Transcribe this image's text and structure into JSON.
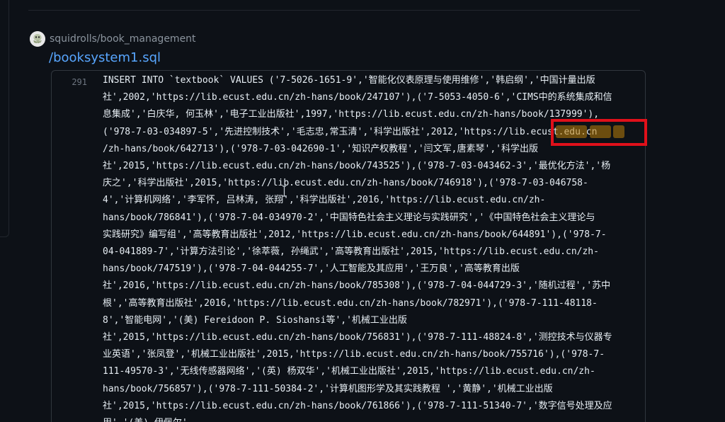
{
  "repo": {
    "name": "squidrolls/book_management",
    "avatar_icon": "squid-avatar-icon"
  },
  "file": {
    "path": "/booksystem1.sql"
  },
  "result": {
    "line_number": "291",
    "code_lines": [
      "INSERT INTO `textbook` VALUES ('7-5026-1651-9','智能化仪表原理与使用维修','韩启纲','中国计量出版",
      "社',2002,'https://lib.ecust.edu.cn/zh-hans/book/247107'),('7-5053-4050-6','CIMS中的系统集成和信",
      "息集成','白庆华, 何玉林','电子工业出版社',1997,'https://lib.ecust.edu.cn/zh-hans/book/137999'),",
      "('978-7-03-034897-5','先进控制技术','毛志忠,常玉清','科学出版社',2012,'https://lib.ecust.edu.cn",
      "/zh-hans/book/642713'),('978-7-03-042690-1','知识产权教程','闫文军,唐素琴','科学出版",
      "社',2015,'https://lib.ecust.edu.cn/zh-hans/book/743525'),('978-7-03-043462-3','最优化方法','杨",
      "庆之','科学出版社',2015,'https://lib.ecust.edu.cn/zh-hans/book/746918'),('978-7-03-046758-",
      "4','计算机网络','李军怀, 吕林涛, 张翔','科学出版社',2016,'https://lib.ecust.edu.cn/zh-",
      "hans/book/786841'),('978-7-04-034970-2','中国特色社会主义理论与实践研究','《中国特色社会主义理论与",
      "实践研究》编写组','高等教育出版社',2012,'https://lib.ecust.edu.cn/zh-hans/book/644891'),('978-7-",
      "04-041889-7','计算方法引论','徐萃薇, 孙绳武','高等教育出版社',2015,'https://lib.ecust.edu.cn/zh-",
      "hans/book/747519'),('978-7-04-044255-7','人工智能及其应用','王万良','高等教育出版",
      "社',2016,'https://lib.ecust.edu.cn/zh-hans/book/785308'),('978-7-04-044729-3','随机过程','苏中",
      "根','高等教育出版社',2016,'https://lib.ecust.edu.cn/zh-hans/book/782971'),('978-7-111-48118-",
      "8','智能电网','(美) Fereidoon P. Sioshansi等','机械工业出版",
      "社',2015,'https://lib.ecust.edu.cn/zh-hans/book/756831'),('978-7-111-48824-8','测控技术与仪器专",
      "业英语','张凤登','机械工业出版社',2015,'https://lib.ecust.edu.cn/zh-hans/book/755716'),('978-7-",
      "111-49570-3','无线传感器网络','(英) 杨双华','机械工业出版社',2015,'https://lib.ecust.edu.cn/zh-",
      "hans/book/756857'),('978-7-111-50384-2','计算机图形学及其实践教程 ','黄静','机械工业出版",
      "社',2015,'https://lib.ecust.edu.cn/zh-hans/book/761866'),('978-7-111-51340-7','数字信号处理及应",
      "用','(美) 伊佩尔'"
    ],
    "match_highlight_color": "#bb8009"
  },
  "annotation": {
    "box_color": "#e0101a"
  }
}
